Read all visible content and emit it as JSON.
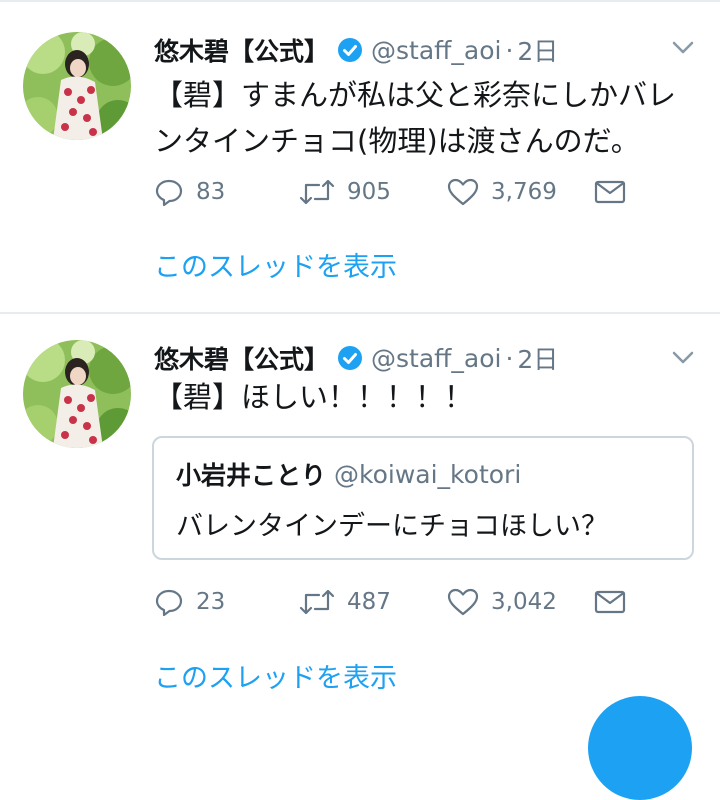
{
  "tweets": [
    {
      "display_name": "悠木碧【公式】",
      "handle": "@staff_aoi",
      "separator": "·",
      "time": "2日",
      "text_line1": "【碧】すまんが私は父と彩奈にしかバレ",
      "text_line2": "ンタインチョコ(物理)は渡さんのだ。",
      "replies": "83",
      "retweets": "905",
      "likes": "3,769",
      "thread_link": "このスレッドを表示"
    },
    {
      "display_name": "悠木碧【公式】",
      "handle": "@staff_aoi",
      "separator": "·",
      "time": "2日",
      "text_line1": "【碧】ほしい！！！！！",
      "quote": {
        "display_name": "小岩井ことり",
        "handle": "@koiwai_kotori",
        "text": "バレンタインデーにチョコほしい？"
      },
      "replies": "23",
      "retweets": "487",
      "likes": "3,042",
      "thread_link": "このスレッドを表示"
    }
  ],
  "colors": {
    "accent": "#1da1f2",
    "text": "#14171a",
    "secondary": "#657786",
    "border": "#e6ecf0"
  },
  "icons": [
    "verified-badge-icon",
    "chevron-down-icon",
    "reply-icon",
    "retweet-icon",
    "like-icon",
    "direct-message-icon",
    "compose-icon"
  ]
}
